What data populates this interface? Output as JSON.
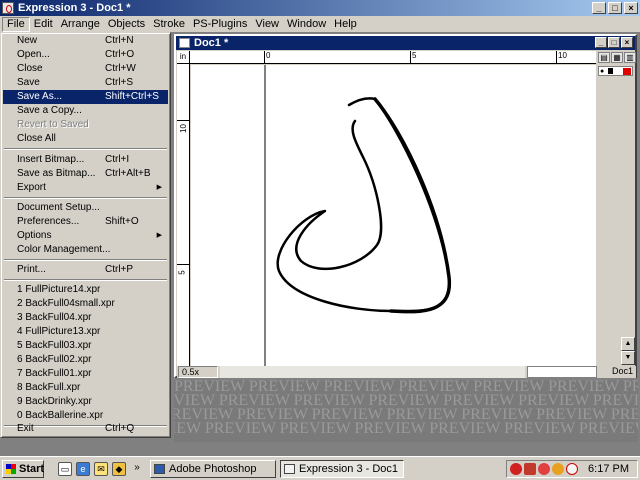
{
  "window": {
    "title": "Expression 3 - Doc1 *",
    "minimize": "_",
    "maximize": "□",
    "close": "×"
  },
  "menubar": [
    "File",
    "Edit",
    "Arrange",
    "Objects",
    "Stroke",
    "PS-Plugins",
    "View",
    "Window",
    "Help"
  ],
  "file_menu": [
    {
      "label": "New",
      "shortcut": "Ctrl+N"
    },
    {
      "label": "Open...",
      "shortcut": "Ctrl+O"
    },
    {
      "label": "Close",
      "shortcut": "Ctrl+W"
    },
    {
      "label": "Save",
      "shortcut": "Ctrl+S"
    },
    {
      "label": "Save As...",
      "shortcut": "Shift+Ctrl+S",
      "highlighted": true
    },
    {
      "label": "Save a Copy..."
    },
    {
      "label": "Revert to Saved",
      "disabled": true
    },
    {
      "label": "Close All"
    },
    {
      "label": "Insert Bitmap...",
      "shortcut": "Ctrl+I"
    },
    {
      "label": "Save as Bitmap...",
      "shortcut": "Ctrl+Alt+B"
    },
    {
      "label": "Export",
      "submenu": true
    },
    {
      "label": "Document Setup..."
    },
    {
      "label": "Preferences...",
      "shortcut": "Shift+O"
    },
    {
      "label": "Options",
      "submenu": true
    },
    {
      "label": "Color Management..."
    },
    {
      "label": "Print...",
      "shortcut": "Ctrl+P"
    },
    {
      "label": "1 FullPicture14.xpr"
    },
    {
      "label": "2 BackFull04small.xpr"
    },
    {
      "label": "3 BackFull04.xpr"
    },
    {
      "label": "4 FullPicture13.xpr"
    },
    {
      "label": "5 BackFull03.xpr"
    },
    {
      "label": "6 BackFull02.xpr"
    },
    {
      "label": "7 BackFull01.xpr"
    },
    {
      "label": "8 BackFull.xpr"
    },
    {
      "label": "9 BackDrinky.xpr"
    },
    {
      "label": "0 BackBallerine.xpr"
    },
    {
      "label": "Exit",
      "shortcut": "Ctrl+Q"
    }
  ],
  "document": {
    "title": "Doc1 *",
    "ruler_unit": "in",
    "h_ruler_labels": [
      "0",
      "5",
      "10"
    ],
    "v_ruler_labels": [
      "10",
      "5"
    ],
    "zoom": "0.5x",
    "status_doc": "Doc1",
    "stroke_color": "#000000",
    "layer_color": "#e00000"
  },
  "preview_text": "PREVIEW PREVIEW PREVIEW PREVIEW PREVIEW PREVIEW PREVIEW PREVIEW",
  "taskbar": {
    "start": "Start",
    "tasks": [
      {
        "label": "Adobe Photoshop",
        "active": false
      },
      {
        "label": "Expression 3 - Doc1 *",
        "active": true
      }
    ],
    "clock": "6:17 PM"
  },
  "icons": {
    "eye": "eye-icon",
    "lock": "lock-icon",
    "start_logo": "windows-logo-icon"
  }
}
